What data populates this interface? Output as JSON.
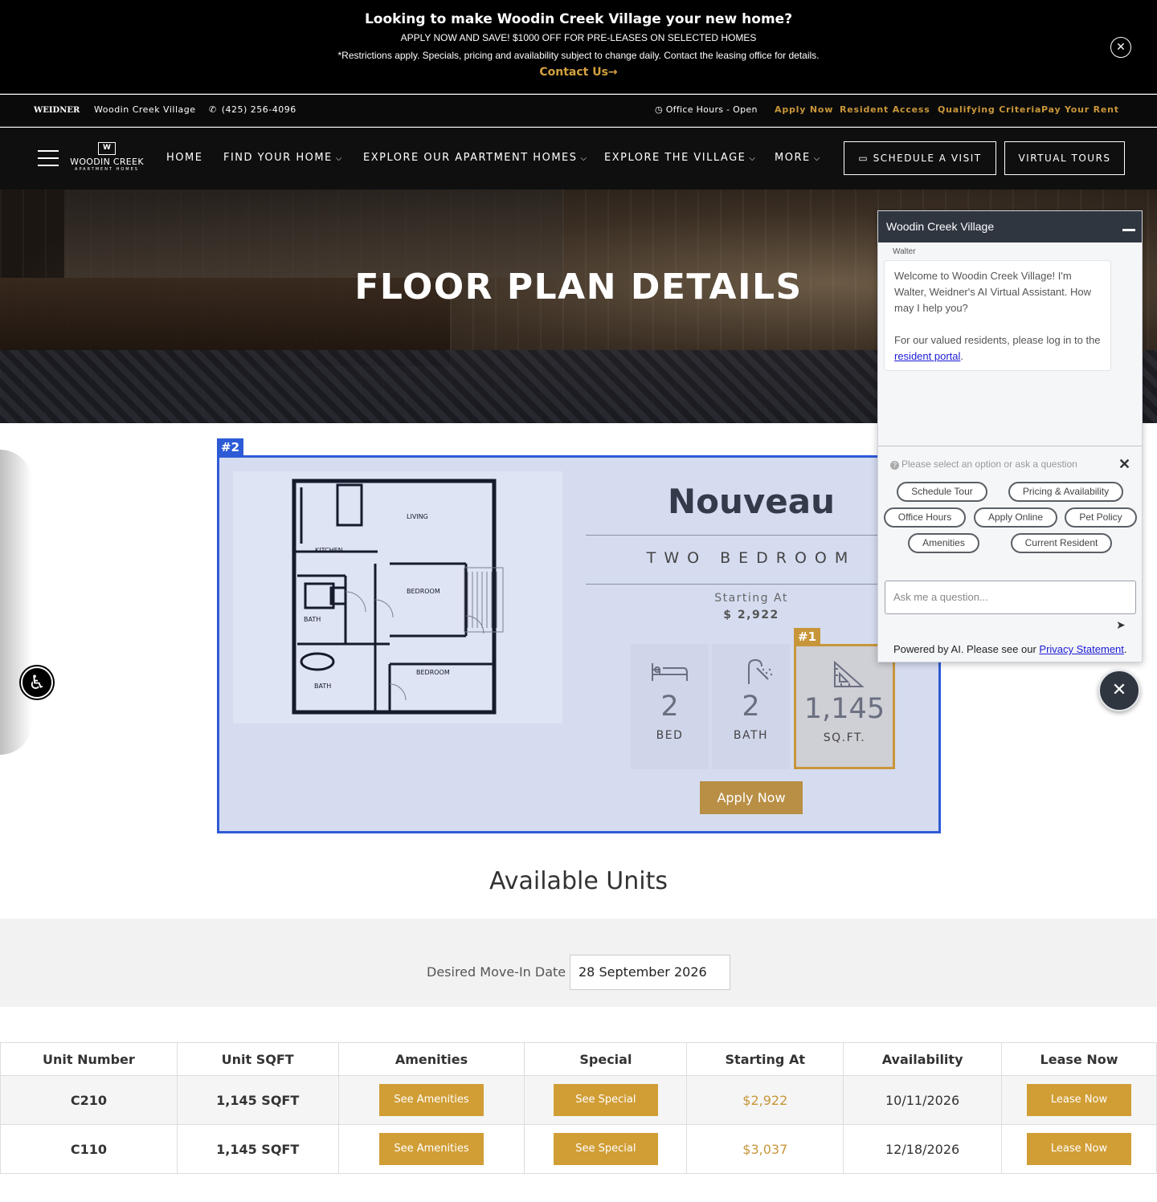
{
  "promo": {
    "title": "Looking to make Woodin Creek Village your new home?",
    "offer": "APPLY NOW AND SAVE! $1000 OFF FOR PRE-LEASES ON SELECTED HOMES",
    "disclaimer": "*Restrictions apply. Specials, pricing and availability subject to change daily. Contact the leasing office for details.",
    "cta": "Contact Us→",
    "close": "✕"
  },
  "utility": {
    "logo": "WEIDNER",
    "property": "Woodin Creek Village",
    "phone": "(425) 256-4096",
    "hours": "Office Hours - Open",
    "links": [
      "Apply Now",
      "Resident Access",
      "Qualifying Criteria",
      "Pay Your Rent"
    ]
  },
  "nav": {
    "brand_name": "WOODIN CREEK",
    "brand_sub": "APARTMENT HOMES",
    "items": [
      "HOME",
      "FIND YOUR HOME",
      "EXPLORE OUR APARTMENT HOMES",
      "EXPLORE THE VILLAGE",
      "MORE"
    ],
    "schedule": "SCHEDULE A VISIT",
    "tours": "VIRTUAL TOURS"
  },
  "hero": {
    "title": "FLOOR PLAN DETAILS"
  },
  "plan": {
    "name": "Nouveau",
    "type": "TWO BEDROOM",
    "starting_label": "Starting At",
    "starting_price": "$ 2,922",
    "beds": "2",
    "beds_label": "BED",
    "baths": "2",
    "baths_label": "BATH",
    "sqft": "1,145",
    "sqft_label": "SQ.FT.",
    "apply": "Apply Now",
    "rooms": [
      "LIVING",
      "KITCHEN",
      "BEDROOM",
      "BATH",
      "BEDROOM",
      "BATH"
    ]
  },
  "tags": {
    "t1": "#1",
    "t2": "#2"
  },
  "chat": {
    "title": "Woodin Creek Village",
    "agent": "Walter",
    "message1": "Welcome to Woodin Creek Village! I'm Walter, Weidner's AI Virtual Assistant. How may I help you?",
    "message2": "For our valued residents, please log in to the",
    "link": "resident portal",
    "prompt": "Please select an option or ask a question",
    "chips": [
      "Schedule Tour",
      "Pricing & Availability",
      "Office Hours",
      "Apply Online",
      "Pet Policy",
      "Amenities",
      "Current Resident"
    ],
    "placeholder": "Ask me a question...",
    "footer": "Powered by AI. Please see our",
    "footer_link": "Privacy Statement"
  },
  "units": {
    "title": "Available Units",
    "movein_label": "Desired Move-In Date",
    "movein_date": "28 September 2026",
    "headers": [
      "Unit Number",
      "Unit SQFT",
      "Amenities",
      "Special",
      "Starting At",
      "Availability",
      "Lease Now"
    ],
    "rows": [
      {
        "unit": "C210",
        "sqft": "1,145 SQFT",
        "amenities": "See Amenities",
        "special": "See Special",
        "price": "$2,922",
        "available": "10/11/2026",
        "lease": "Lease Now"
      },
      {
        "unit": "C110",
        "sqft": "1,145 SQFT",
        "amenities": "See Amenities",
        "special": "See Special",
        "price": "$3,037",
        "available": "12/18/2026",
        "lease": "Lease Now"
      }
    ]
  },
  "colors": {
    "gold": "#c8963a",
    "highlight_blue": "#2d5bd6",
    "nav_bg": "#0f0f0f"
  }
}
